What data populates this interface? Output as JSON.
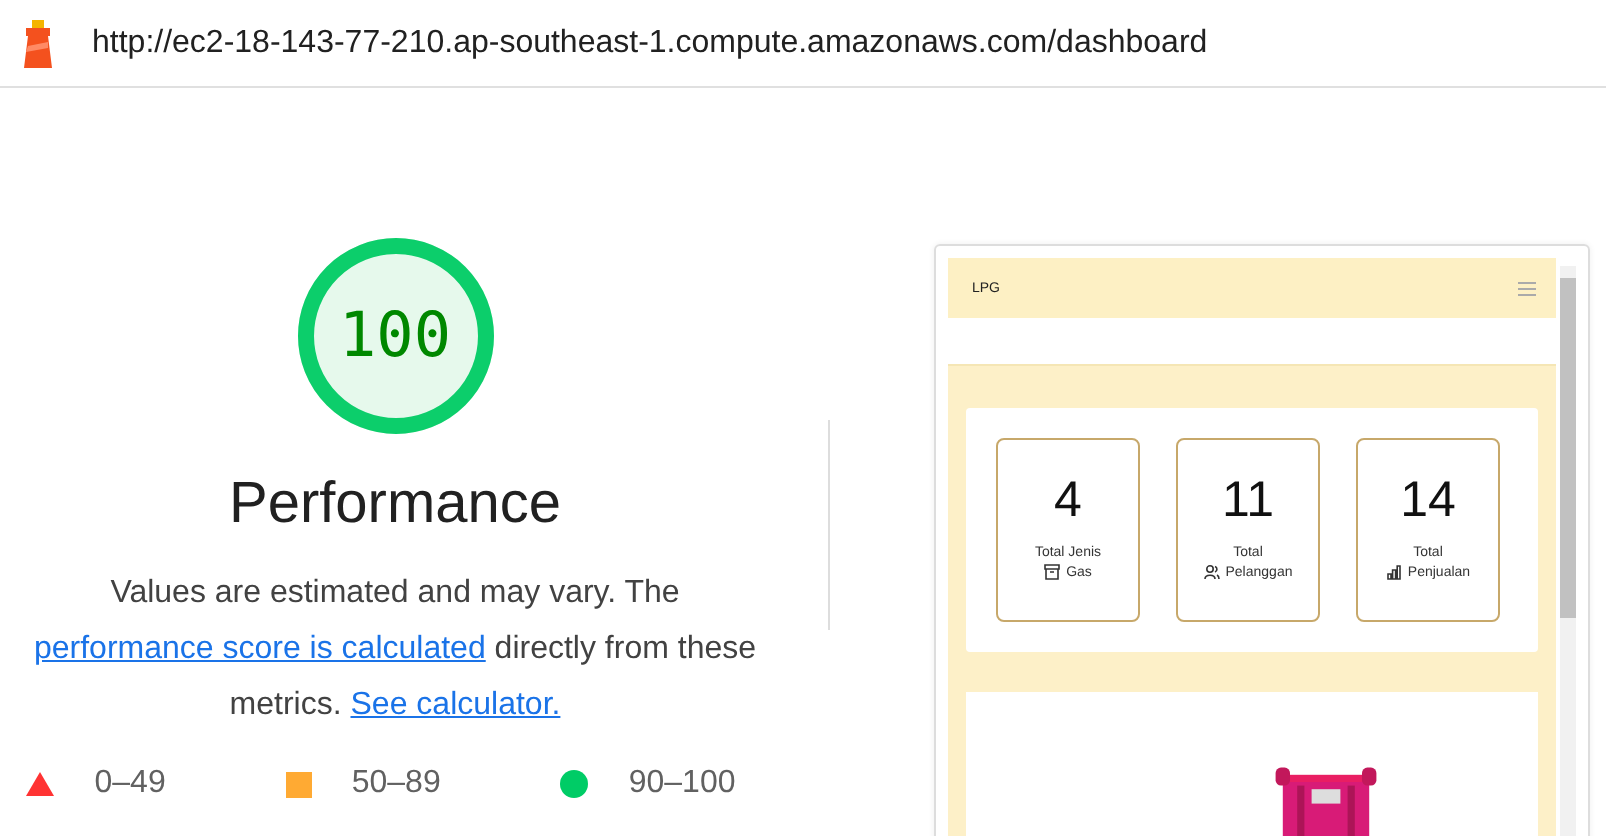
{
  "address_bar": {
    "url": "http://ec2-18-143-77-210.ap-southeast-1.compute.amazonaws.com/dashboard"
  },
  "gauge": {
    "score": "100",
    "level": 1,
    "title": "Performance"
  },
  "description": {
    "before": "Values are estimated and may vary. The",
    "link": "performance score is calculated",
    "middle": "directly from these metrics.",
    "link2": "See calculator."
  },
  "legend": [
    {
      "kind": "triangle",
      "color": "#ff3333",
      "label": "0–49"
    },
    {
      "kind": "square",
      "color": "#ffaa33",
      "label": "50–89"
    },
    {
      "kind": "circle",
      "color": "#00cc66",
      "label": "90–100"
    }
  ],
  "preview": {
    "brand": "LPG",
    "stats": [
      {
        "value": "4",
        "label_top": "Total Jenis",
        "label": "Gas",
        "kind": "box"
      },
      {
        "value": "11",
        "label_top": "Total",
        "label": "Pelanggan",
        "kind": "people"
      },
      {
        "value": "14",
        "label_top": "Total",
        "label": "Penjualan",
        "kind": "chart"
      }
    ]
  }
}
